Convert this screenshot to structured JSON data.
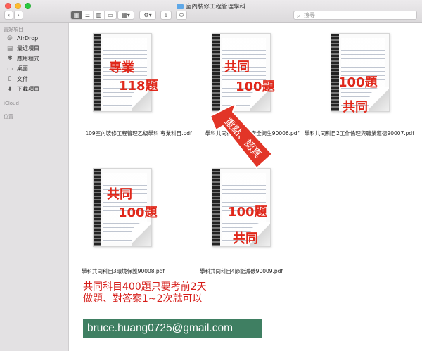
{
  "window": {
    "title": "室內裝修工程管理學科"
  },
  "toolbar": {
    "back_label": "‹",
    "forward_label": "›",
    "search_placeholder": "搜尋",
    "view_modes": [
      "icon-view",
      "list-view",
      "column-view",
      "gallery-view"
    ]
  },
  "sidebar": {
    "favorites_title": "喜好項目",
    "items": [
      {
        "label": "AirDrop",
        "icon": "airdrop-icon"
      },
      {
        "label": "最近項目",
        "icon": "recents-icon"
      },
      {
        "label": "應用程式",
        "icon": "applications-icon"
      },
      {
        "label": "桌面",
        "icon": "desktop-icon"
      },
      {
        "label": "文件",
        "icon": "documents-icon"
      },
      {
        "label": "下載項目",
        "icon": "downloads-icon"
      }
    ],
    "icloud_title": "iCloud",
    "locations_title": "位置"
  },
  "files": [
    {
      "name": "109室內裝修工程管理乙級學科 專業科目.pdf",
      "overlay_1": "專業",
      "overlay_2": "118題"
    },
    {
      "name": "學科共同科目1職業安全衛生90006.pdf",
      "overlay_1": "共同",
      "overlay_2": "100題"
    },
    {
      "name": "學科共同科目2工作倫理與職業道德90007.pdf",
      "overlay_1": "100題",
      "overlay_2": "共同"
    },
    {
      "name": "學科共同科目3環境保護90008.pdf",
      "overlay_1": "共同",
      "overlay_2": "100題"
    },
    {
      "name": "學科共同科目4節能減碳90009.pdf",
      "overlay_1": "100題",
      "overlay_2": "共同"
    }
  ],
  "arrow_text": "重點、認真",
  "note": {
    "line1": "共同科目400題只要考前2天",
    "line2": "做題、對答案1~2次就可以"
  },
  "email": "bruce.huang0725@gmail.com",
  "colors": {
    "accent_red": "#e0281b",
    "email_bg": "#3f7f62",
    "sidebar_bg": "#e3e1e3"
  }
}
